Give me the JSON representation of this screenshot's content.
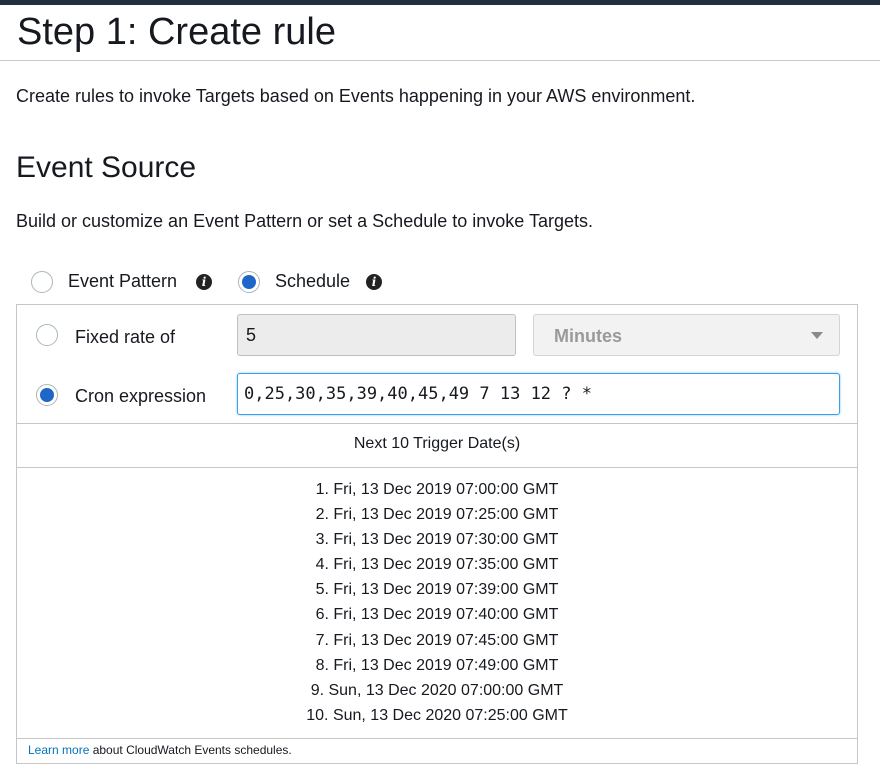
{
  "header": {
    "title": "Step 1: Create rule",
    "description": "Create rules to invoke Targets based on Events happening in your AWS environment."
  },
  "event_source": {
    "title": "Event Source",
    "description": "Build or customize an Event Pattern or set a Schedule to invoke Targets.",
    "source_options": [
      {
        "label": "Event Pattern",
        "selected": false,
        "icon": "info-icon"
      },
      {
        "label": "Schedule",
        "selected": true,
        "icon": "info-icon"
      }
    ]
  },
  "schedule": {
    "fixed_rate": {
      "label": "Fixed rate of",
      "selected": false,
      "value": "5",
      "unit": "Minutes"
    },
    "cron": {
      "label": "Cron expression",
      "selected": true,
      "value": "0,25,30,35,39,40,45,49 7 13 12 ? *"
    },
    "trigger_dates_header": "Next 10 Trigger Date(s)",
    "trigger_dates": [
      "1. Fri, 13 Dec 2019 07:00:00 GMT",
      "2. Fri, 13 Dec 2019 07:25:00 GMT",
      "3. Fri, 13 Dec 2019 07:30:00 GMT",
      "4. Fri, 13 Dec 2019 07:35:00 GMT",
      "5. Fri, 13 Dec 2019 07:39:00 GMT",
      "6. Fri, 13 Dec 2019 07:40:00 GMT",
      "7. Fri, 13 Dec 2019 07:45:00 GMT",
      "8. Fri, 13 Dec 2019 07:49:00 GMT",
      "9. Sun, 13 Dec 2020 07:00:00 GMT",
      "10. Sun, 13 Dec 2020 07:25:00 GMT"
    ],
    "footnote": {
      "link_text": "Learn more",
      "text": " about CloudWatch Events schedules."
    }
  },
  "colors": {
    "radio_selected": "#1e66c8",
    "link": "#0073bb",
    "focus_border": "#3aa0e8"
  }
}
